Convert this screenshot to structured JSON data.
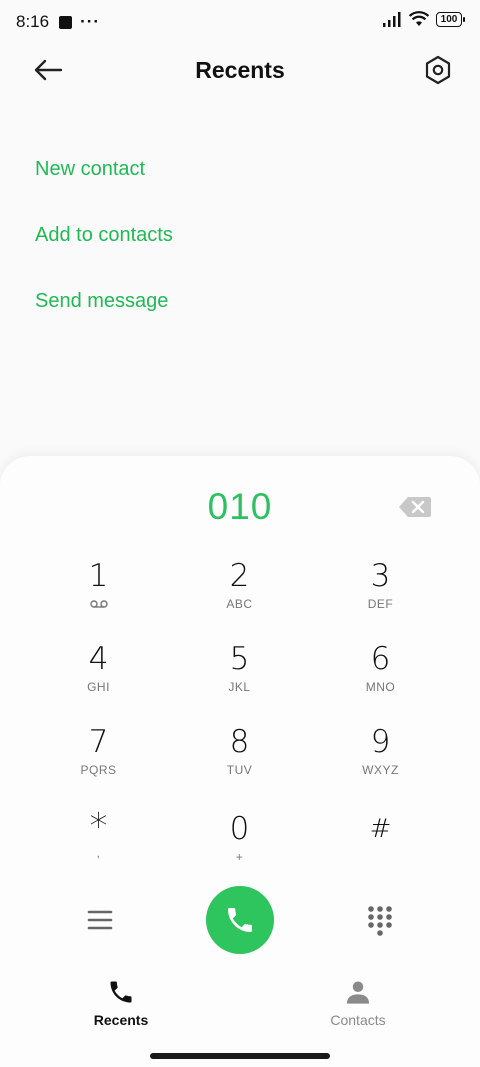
{
  "status_bar": {
    "time": "8:16",
    "dots": "···",
    "battery": "100"
  },
  "header": {
    "title": "Recents"
  },
  "actions": {
    "new_contact": "New contact",
    "add_to_contacts": "Add to contacts",
    "send_message": "Send message"
  },
  "dialer": {
    "number": "010",
    "keys": [
      {
        "digit": "1",
        "letters": ""
      },
      {
        "digit": "2",
        "letters": "ABC"
      },
      {
        "digit": "3",
        "letters": "DEF"
      },
      {
        "digit": "4",
        "letters": "GHI"
      },
      {
        "digit": "5",
        "letters": "JKL"
      },
      {
        "digit": "6",
        "letters": "MNO"
      },
      {
        "digit": "7",
        "letters": "PQRS"
      },
      {
        "digit": "8",
        "letters": "TUV"
      },
      {
        "digit": "9",
        "letters": "WXYZ"
      },
      {
        "digit": "*",
        "letters": ","
      },
      {
        "digit": "0",
        "letters": "+"
      },
      {
        "digit": "#",
        "letters": ""
      }
    ]
  },
  "bottom_nav": {
    "recents": "Recents",
    "contacts": "Contacts"
  },
  "colors": {
    "accent": "#20b955",
    "call": "#2ec45e"
  },
  "icons": {
    "back": "back-arrow-icon",
    "settings": "settings-hex-icon",
    "backspace": "backspace-icon",
    "voicemail": "voicemail-icon",
    "menu": "menu-icon",
    "call": "phone-icon",
    "keypad": "dialpad-icon",
    "recents": "phone-icon",
    "contacts": "person-icon"
  }
}
